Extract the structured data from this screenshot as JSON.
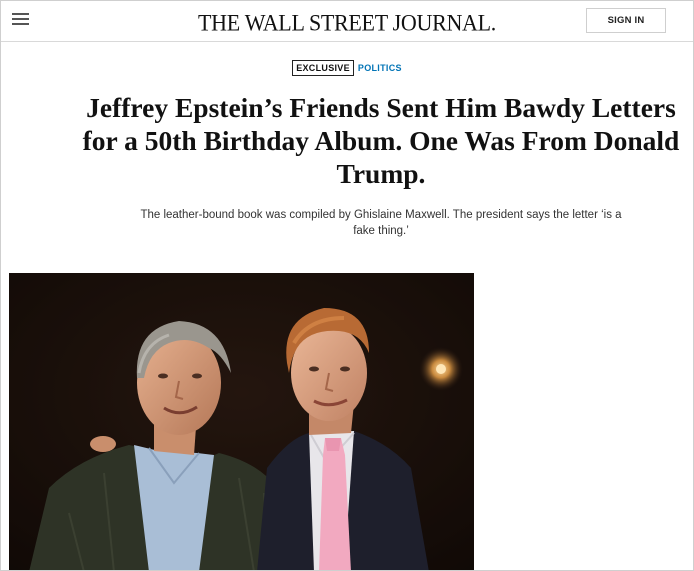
{
  "header": {
    "menu_icon": "hamburger-menu-icon",
    "logo": "THE WALL STREET JOURNAL.",
    "signin_label": "SIGN IN"
  },
  "article": {
    "badge": "EXCLUSIVE",
    "section": "POLITICS",
    "headline": "Jeffrey Epstein’s Friends Sent Him Bawdy Letters for a 50th Birthday Album. One Was From Donald Trump.",
    "dek": "The leather-bound book was compiled by Ghislaine Maxwell. The president says the letter ‘is a fake thing.’"
  },
  "colors": {
    "section_link": "#0274b6",
    "text": "#111111",
    "photo_background": "#0f0a08"
  }
}
